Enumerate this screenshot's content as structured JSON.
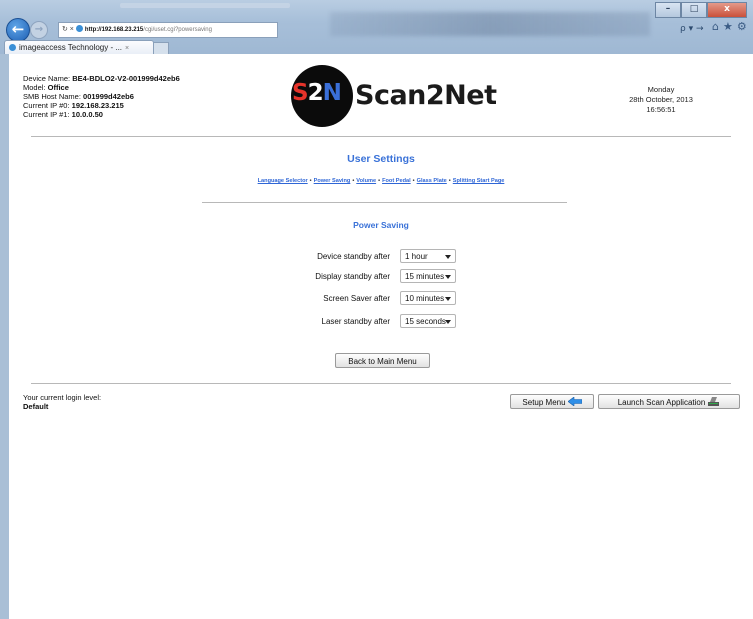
{
  "browser": {
    "address_host": "http://192.168.23.215",
    "address_path": "/cgi/uset.cgi?powersaving",
    "search_label": "ρ ▾ →",
    "tab_title": "imageaccess Technology - ...",
    "tab_close": "×",
    "window_buttons": {
      "minimize": "–",
      "maximize": "□",
      "close": "x"
    },
    "nav_icons": "⌂★⚙"
  },
  "device": {
    "name_label": "Device Name:",
    "name_value": "BE4-BDLO2-V2-001999d42eb6",
    "model_label": "Model:",
    "model_value": "Office",
    "smb_label": "SMB Host Name:",
    "smb_value": "001999d42eb6",
    "ip0_label": "Current IP #0:",
    "ip0_value": "192.168.23.215",
    "ip1_label": "Current IP #1:",
    "ip1_value": "10.0.0.50"
  },
  "logo": {
    "mark_s": "S",
    "mark_2": "2",
    "mark_n": "N",
    "word": "Scan2Net"
  },
  "datetime": {
    "day": "Monday",
    "date": "28th October, 2013",
    "time": "16:56:51"
  },
  "user_settings": {
    "heading": "User Settings",
    "links": [
      "Language Selector",
      "Power Saving",
      "Volume",
      "Foot Pedal",
      "Glass Plate",
      "Splitting Start Page"
    ],
    "separator": "•"
  },
  "power_saving": {
    "heading": "Power Saving",
    "rows": [
      {
        "label": "Device standby after",
        "value": "1 hour"
      },
      {
        "label": "Display standby after",
        "value": "15 minutes"
      },
      {
        "label": "Screen Saver after",
        "value": "10 minutes"
      },
      {
        "label": "Laser standby after",
        "value": "15 seconds"
      }
    ],
    "back_button": "Back to Main Menu"
  },
  "footer": {
    "login_label": "Your current login level:",
    "login_value": "Default",
    "setup_button": "Setup Menu",
    "launch_button": "Launch Scan Application"
  },
  "colors": {
    "heading": "#3a72d8",
    "link": "#2f66d6",
    "logo_red": "#e6332a",
    "logo_blue": "#3a6fd8"
  }
}
